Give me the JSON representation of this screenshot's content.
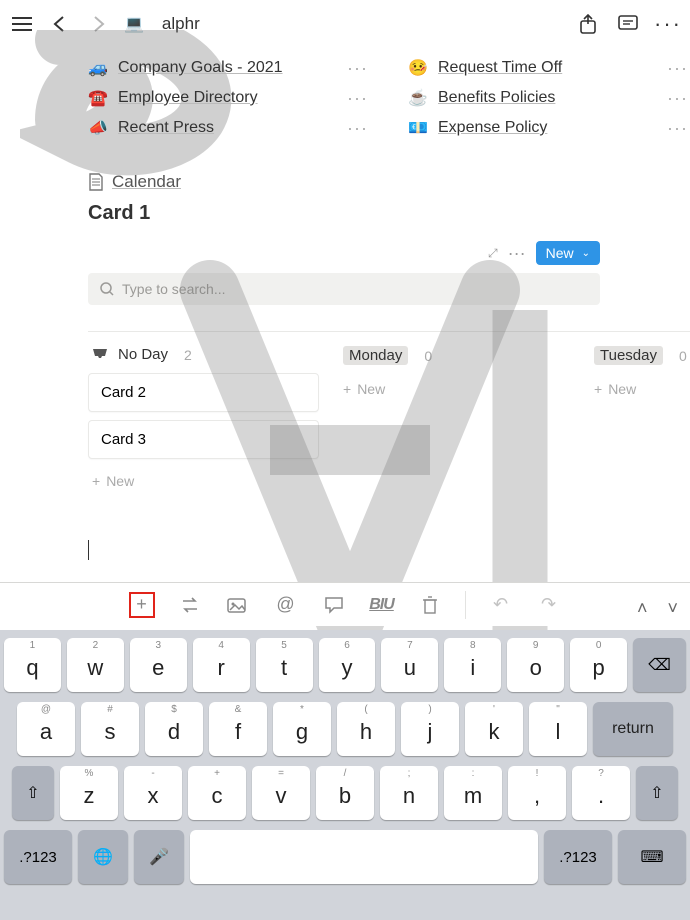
{
  "header": {
    "title": "alphr"
  },
  "links": {
    "left": [
      {
        "emoji": "🚙",
        "label": "Company Goals - 2021"
      },
      {
        "emoji": "☎️",
        "label": "Employee Directory"
      },
      {
        "emoji": "📣",
        "label": "Recent Press"
      }
    ],
    "right": [
      {
        "emoji": "🤒",
        "label": "Request Time Off"
      },
      {
        "emoji": "☕️",
        "label": "Benefits Policies"
      },
      {
        "emoji": "💶",
        "label": "Expense Policy"
      }
    ]
  },
  "section": {
    "calendar_label": "Calendar",
    "card_title": "Card 1"
  },
  "controls": {
    "new_label": "New"
  },
  "search": {
    "placeholder": "Type to search..."
  },
  "board": {
    "columns": [
      {
        "label": "No Day",
        "count": "2",
        "pill": false,
        "cards": [
          "Card 2",
          "Card 3"
        ]
      },
      {
        "label": "Monday",
        "count": "0",
        "pill": true,
        "cards": []
      },
      {
        "label": "Tuesday",
        "count": "0",
        "pill": true,
        "cards": []
      }
    ],
    "add_new_label": "New"
  },
  "toolbar": {
    "format_label": "BIU"
  },
  "keyboard": {
    "row1": [
      [
        "1",
        "q"
      ],
      [
        "2",
        "w"
      ],
      [
        "3",
        "e"
      ],
      [
        "4",
        "r"
      ],
      [
        "5",
        "t"
      ],
      [
        "6",
        "y"
      ],
      [
        "7",
        "u"
      ],
      [
        "8",
        "i"
      ],
      [
        "9",
        "o"
      ],
      [
        "0",
        "p"
      ]
    ],
    "row2": [
      [
        "@",
        "a"
      ],
      [
        "#",
        "s"
      ],
      [
        "$",
        "d"
      ],
      [
        "&",
        "f"
      ],
      [
        "*",
        "g"
      ],
      [
        "(",
        "h"
      ],
      [
        ")",
        "j"
      ],
      [
        "'",
        "k"
      ],
      [
        "\"",
        "l"
      ]
    ],
    "row3": [
      [
        "%",
        "z"
      ],
      [
        "-",
        "x"
      ],
      [
        "+",
        "c"
      ],
      [
        "=",
        "v"
      ],
      [
        "/",
        "b"
      ],
      [
        ";",
        "n"
      ],
      [
        ":",
        "m"
      ],
      [
        "!",
        ","
      ],
      [
        "?",
        "."
      ]
    ],
    "return_label": "return",
    "numbers_label": ".?123"
  }
}
